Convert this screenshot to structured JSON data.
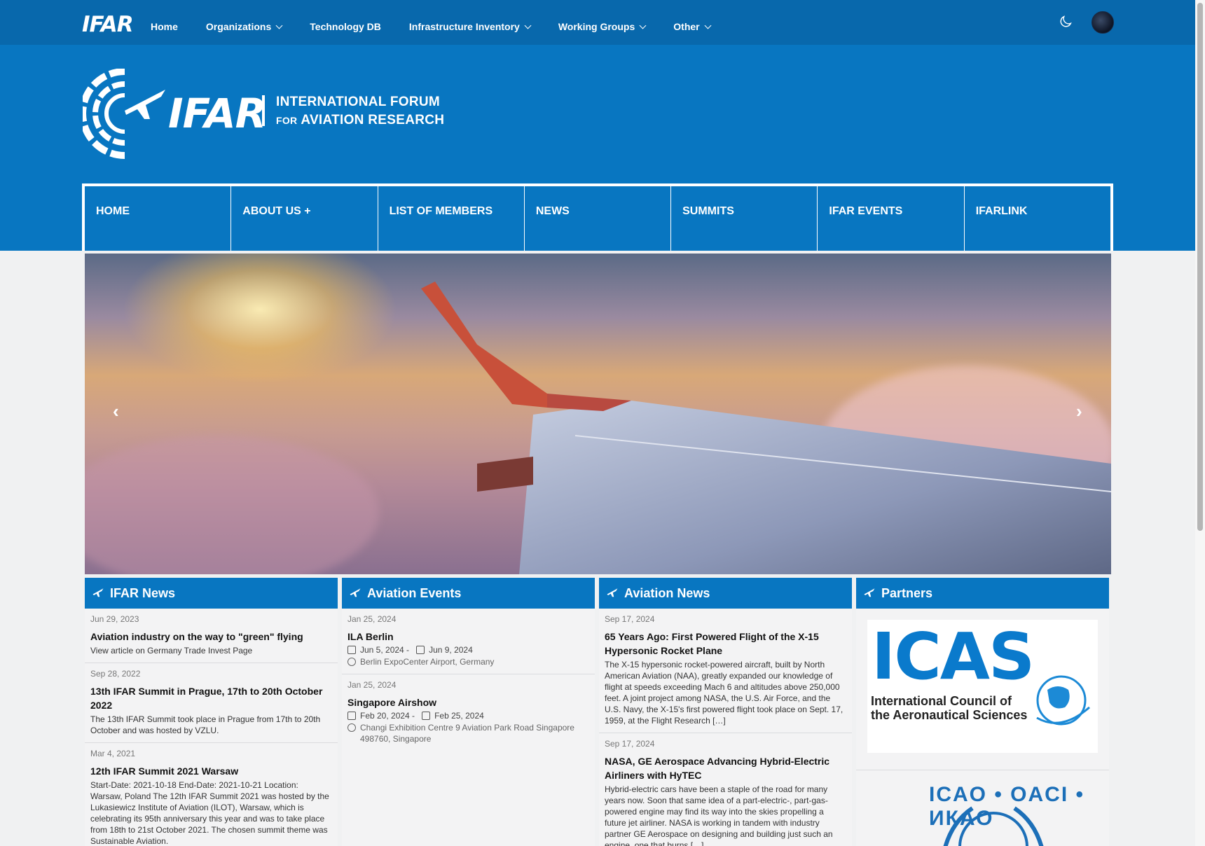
{
  "topnav": {
    "brand": "IFAR",
    "items": [
      {
        "label": "Home",
        "dropdown": false
      },
      {
        "label": "Organizations",
        "dropdown": true
      },
      {
        "label": "Technology DB",
        "dropdown": false
      },
      {
        "label": "Infrastructure Inventory",
        "dropdown": true
      },
      {
        "label": "Working Groups",
        "dropdown": true
      },
      {
        "label": "Other",
        "dropdown": true
      }
    ]
  },
  "logo": {
    "mark": "IFAR",
    "line1": "INTERNATIONAL FORUM",
    "line2_prefix": "FOR",
    "line2": "AVIATION RESEARCH"
  },
  "menu": [
    "HOME",
    "ABOUT US +",
    "LIST OF MEMBERS",
    "NEWS",
    "SUMMITS",
    "IFAR EVENTS",
    "IFARLINK"
  ],
  "hero": {
    "prev": "‹",
    "next": "›"
  },
  "panels": {
    "ifar_news": {
      "title": "IFAR News",
      "items": [
        {
          "date": "Jun 29, 2023",
          "title": "Aviation industry on the way to \"green\" flying",
          "text": "View article on Germany Trade Invest Page"
        },
        {
          "date": "Sep 28, 2022",
          "title": "13th IFAR Summit in Prague, 17th to 20th October 2022",
          "text": "The 13th IFAR Summit took place in Prague from 17th to 20th October and was hosted by VZLU."
        },
        {
          "date": "Mar 4, 2021",
          "title": "12th IFAR Summit 2021 Warsaw",
          "text": "Start-Date: 2021-10-18 End-Date: 2021-10-21 Location: Warsaw, Poland The 12th IFAR Summit 2021 was hosted by the Lukasiewicz Institute of Aviation (ILOT), Warsaw, which is celebrating its 95th anniversary this year and was to take place from 18th to 21st October 2021. The chosen summit theme was Sustainable Aviation."
        }
      ]
    },
    "aviation_events": {
      "title": "Aviation Events",
      "items": [
        {
          "date": "Jan 25, 2024",
          "title": "ILA Berlin",
          "start": "Jun 5, 2024 -",
          "end": "Jun 9, 2024",
          "location": "Berlin ExpoCenter Airport, Germany"
        },
        {
          "date": "Jan 25, 2024",
          "title": "Singapore Airshow",
          "start": "Feb 20, 2024 -",
          "end": "Feb 25, 2024",
          "location": "Changi Exhibition Centre 9 Aviation Park Road Singapore 498760, Singapore"
        }
      ]
    },
    "aviation_news": {
      "title": "Aviation News",
      "items": [
        {
          "date": "Sep 17, 2024",
          "title": "65 Years Ago: First Powered Flight of the X-15 Hypersonic Rocket Plane",
          "text": "The X-15 hypersonic rocket-powered aircraft, built by North American Aviation (NAA), greatly expanded our knowledge of flight at speeds exceeding Mach 6 and altitudes above 250,000 feet. A joint project among NASA, the U.S. Air Force, and the U.S. Navy, the X-15's first powered flight took place on Sept. 17, 1959, at the Flight Research […]"
        },
        {
          "date": "Sep 17, 2024",
          "title": "NASA, GE Aerospace Advancing Hybrid-Electric Airliners with HyTEC",
          "text": "Hybrid-electric cars have been a staple of the road for many years now. Soon that same idea of a part-electric-, part-gas-powered engine may find its way into the skies propelling a future jet airliner. NASA is working in tandem with industry partner GE Aerospace on designing and building just such an engine, one that burns […]"
        }
      ]
    },
    "partners": {
      "title": "Partners",
      "icas_logo": "ICAS",
      "icas_line1": "International Council of",
      "icas_line2": "the Aeronautical Sciences",
      "icao_text": "ICAO • OACI • ИКАО"
    }
  },
  "colors": {
    "primary": "#0876c1",
    "navbar": "#0868ac"
  }
}
